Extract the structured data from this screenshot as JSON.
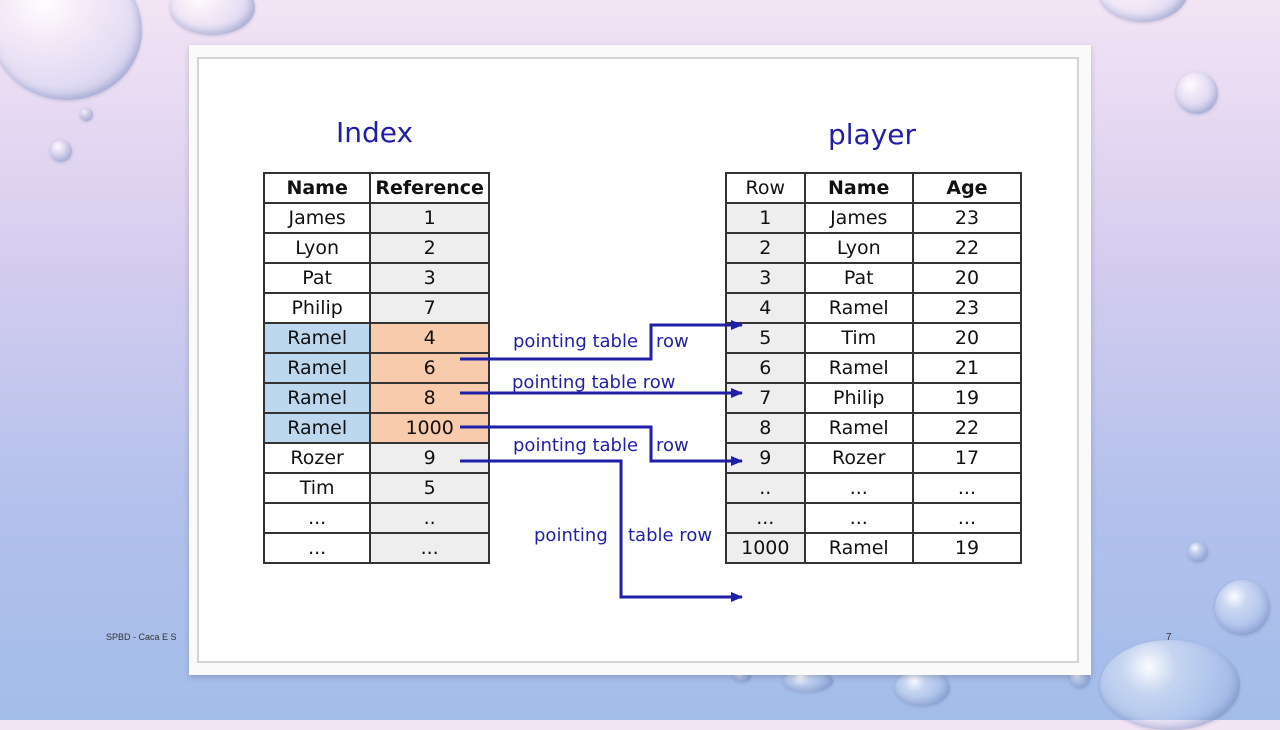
{
  "index_table": {
    "title": "Index",
    "headers": [
      "Name",
      "Reference"
    ],
    "rows": [
      {
        "name": "James",
        "ref": "1",
        "highlight": false
      },
      {
        "name": "Lyon",
        "ref": "2",
        "highlight": false
      },
      {
        "name": "Pat",
        "ref": "3",
        "highlight": false
      },
      {
        "name": "Philip",
        "ref": "7",
        "highlight": false
      },
      {
        "name": "Ramel",
        "ref": "4",
        "highlight": true
      },
      {
        "name": "Ramel",
        "ref": "6",
        "highlight": true
      },
      {
        "name": "Ramel",
        "ref": "8",
        "highlight": true
      },
      {
        "name": "Ramel",
        "ref": "1000",
        "highlight": true
      },
      {
        "name": "Rozer",
        "ref": "9",
        "highlight": false
      },
      {
        "name": "Tim",
        "ref": "5",
        "highlight": false
      },
      {
        "name": "...",
        "ref": "..",
        "highlight": false
      },
      {
        "name": "...",
        "ref": "...",
        "highlight": false
      }
    ]
  },
  "player_table": {
    "title": "player",
    "headers": [
      "Row",
      "Name",
      "Age"
    ],
    "rows": [
      {
        "row": "1",
        "name": "James",
        "age": "23"
      },
      {
        "row": "2",
        "name": "Lyon",
        "age": "22"
      },
      {
        "row": "3",
        "name": "Pat",
        "age": "20"
      },
      {
        "row": "4",
        "name": "Ramel",
        "age": "23"
      },
      {
        "row": "5",
        "name": "Tim",
        "age": "20"
      },
      {
        "row": "6",
        "name": "Ramel",
        "age": "21"
      },
      {
        "row": "7",
        "name": "Philip",
        "age": "19"
      },
      {
        "row": "8",
        "name": "Ramel",
        "age": "22"
      },
      {
        "row": "9",
        "name": "Rozer",
        "age": "17"
      },
      {
        "row": "..",
        "name": "...",
        "age": "..."
      },
      {
        "row": "...",
        "name": "...",
        "age": "..."
      },
      {
        "row": "1000",
        "name": "Ramel",
        "age": "19"
      }
    ]
  },
  "arrows": [
    {
      "from_row": 4,
      "to_row": 3,
      "label_left": "pointing table",
      "label_right": "row"
    },
    {
      "from_row": 5,
      "to_row": 5,
      "label_left": "pointing table row",
      "label_right": ""
    },
    {
      "from_row": 6,
      "to_row": 7,
      "label_left": "pointing table",
      "label_right": "row"
    },
    {
      "from_row": 7,
      "to_row": 11,
      "label_left": "pointing",
      "label_right": "table row"
    }
  ],
  "colors": {
    "title": "#1f1fa8",
    "arrow": "#1f1fa8",
    "highlight_name": "#bdd7ee",
    "highlight_ref": "#f8cbad",
    "cell_gray": "#eeeeee"
  },
  "footer": {
    "text": "SPBD - Caca E S",
    "slide_number": "7"
  }
}
